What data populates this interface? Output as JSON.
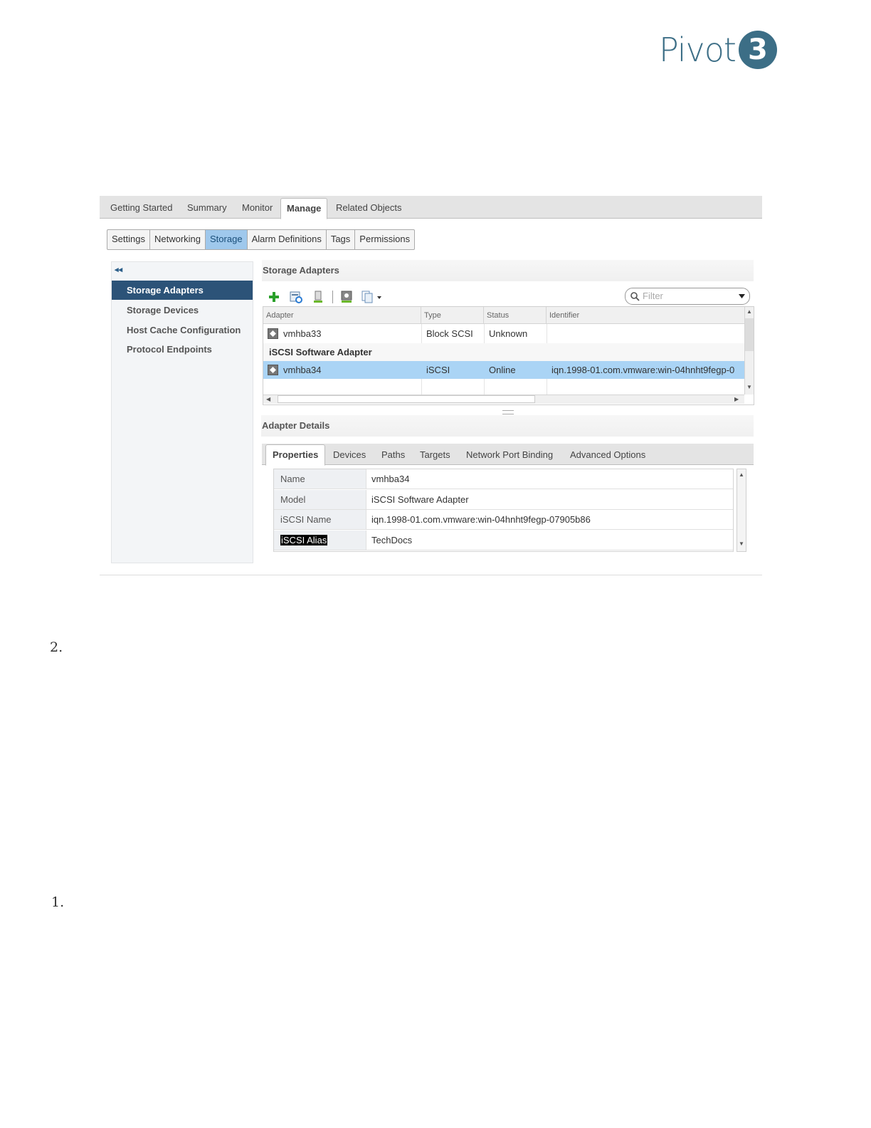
{
  "logo": {
    "text": "Pivot",
    "mark": "3"
  },
  "top_tabs": [
    {
      "label": "Getting Started"
    },
    {
      "label": "Summary"
    },
    {
      "label": "Monitor"
    },
    {
      "label": "Manage"
    },
    {
      "label": "Related Objects"
    }
  ],
  "top_tabs_active": "Manage",
  "sub_tabs": [
    {
      "label": "Settings"
    },
    {
      "label": "Networking"
    },
    {
      "label": "Storage"
    },
    {
      "label": "Alarm Definitions"
    },
    {
      "label": "Tags"
    },
    {
      "label": "Permissions"
    }
  ],
  "sub_tabs_active": "Storage",
  "nav": {
    "collapse_glyph": "◂◂",
    "items": [
      {
        "label": "Storage Adapters"
      },
      {
        "label": "Storage Devices"
      },
      {
        "label": "Host Cache Configuration"
      },
      {
        "label": "Protocol Endpoints"
      }
    ],
    "active": "Storage Adapters"
  },
  "storage_adapters": {
    "title": "Storage Adapters",
    "toolbar_icons": [
      "add-icon",
      "rescan-icon",
      "rescan-adapter-icon",
      "refresh-icon",
      "export-icon"
    ],
    "filter_placeholder": "Filter",
    "columns": [
      "Adapter",
      "Type",
      "Status",
      "Identifier"
    ],
    "rows": [
      {
        "adapter": "vmhba33",
        "type": "Block SCSI",
        "status": "Unknown",
        "identifier": ""
      }
    ],
    "group": {
      "label": "iSCSI Software Adapter",
      "rows": [
        {
          "adapter": "vmhba34",
          "type": "iSCSI",
          "status": "Online",
          "identifier": "iqn.1998-01.com.vmware:win-04hnht9fegp-0"
        }
      ]
    }
  },
  "adapter_details": {
    "title": "Adapter Details",
    "tabs": [
      {
        "label": "Properties"
      },
      {
        "label": "Devices"
      },
      {
        "label": "Paths"
      },
      {
        "label": "Targets"
      },
      {
        "label": "Network Port Binding"
      },
      {
        "label": "Advanced Options"
      }
    ],
    "active_tab": "Properties",
    "properties": [
      {
        "key": "Name",
        "value": "vmhba34"
      },
      {
        "key": "Model",
        "value": "iSCSI Software Adapter"
      },
      {
        "key": "iSCSI Name",
        "value": "iqn.1998-01.com.vmware:win-04hnht9fegp-07905b86"
      },
      {
        "key": "iSCSI Alias",
        "value": "TechDocs"
      }
    ]
  },
  "list_numbers": [
    "2.",
    "1."
  ]
}
